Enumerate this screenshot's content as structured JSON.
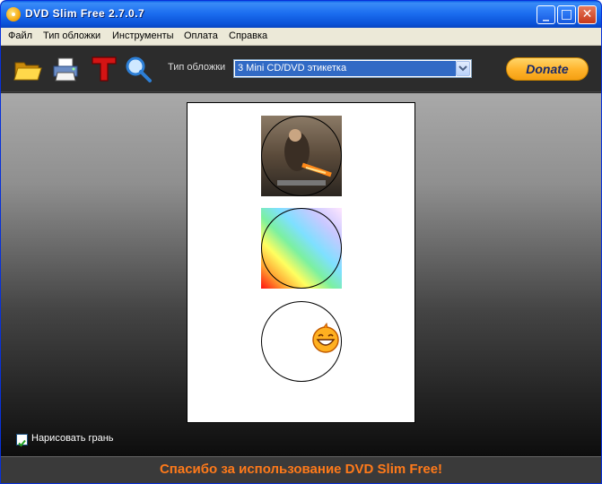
{
  "window": {
    "title": "DVD Slim Free 2.7.0.7",
    "controls": {
      "minimize": "_",
      "maximize": "□",
      "close": "✕"
    }
  },
  "menu": [
    "Файл",
    "Тип обложки",
    "Инструменты",
    "Оплата",
    "Справка"
  ],
  "toolbar": {
    "tools": [
      {
        "name": "open-folder-icon",
        "tooltip": ""
      },
      {
        "name": "print-icon",
        "tooltip": ""
      },
      {
        "name": "text-tool-icon",
        "tooltip": ""
      },
      {
        "name": "zoom-icon",
        "tooltip": ""
      }
    ],
    "cover_type_label": "Тип обложки",
    "cover_type_value": "3 Mini CD/DVD этикетка",
    "donate_label": "Donate"
  },
  "preview": {
    "discs": [
      {
        "kind": "photo-image",
        "description_icon": "movie-poster-image"
      },
      {
        "kind": "rainbow-gradient",
        "description_icon": "gradient-image"
      },
      {
        "kind": "blank-with-smiley",
        "description_icon": "smiley-icon"
      }
    ]
  },
  "options": {
    "draw_border_label": "Нарисовать грань",
    "draw_border_checked": true
  },
  "status": {
    "message": "Спасибо за использование DVD Slim Free!"
  },
  "colors": {
    "status_text": "#ff7a1a",
    "title_bar": "#0a52d8",
    "selection": "#316ac5",
    "donate": "#ffb52e"
  }
}
